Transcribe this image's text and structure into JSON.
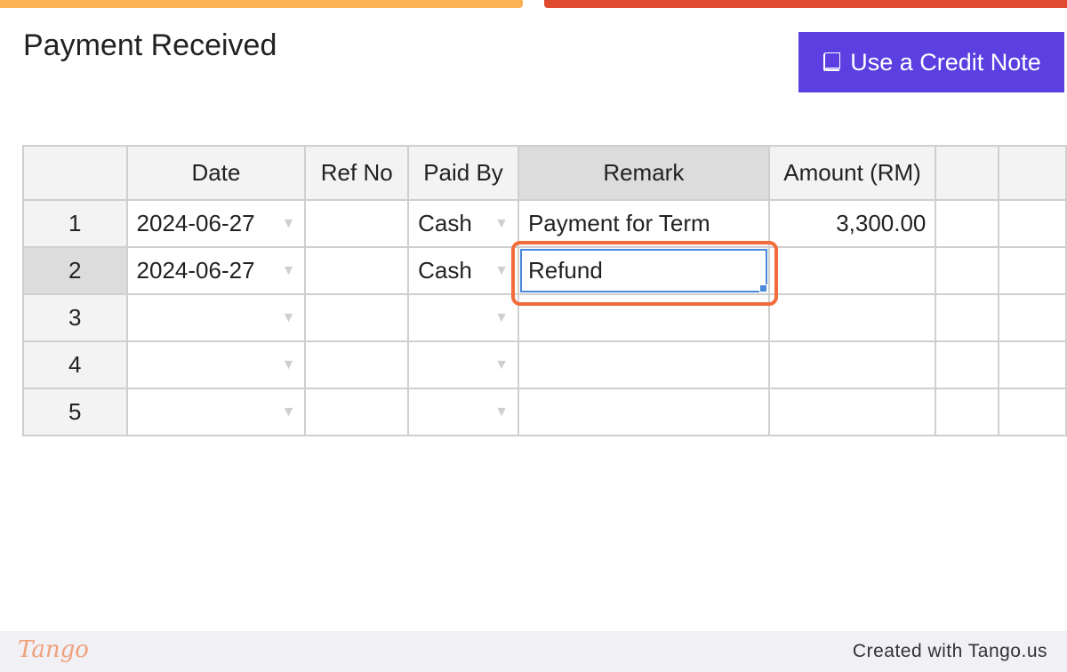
{
  "page_title": "Payment Received",
  "credit_button": {
    "label": "Use a Credit Note",
    "icon": "book-icon"
  },
  "table": {
    "headers": [
      "",
      "Date",
      "Ref No",
      "Paid By",
      "Remark",
      "Amount (RM)",
      "",
      ""
    ],
    "rows": [
      {
        "num": "1",
        "date": "2024-06-27",
        "ref": "",
        "paid_by": "Cash",
        "remark": "Payment for Term",
        "amount": "3,300.00"
      },
      {
        "num": "2",
        "date": "2024-06-27",
        "ref": "",
        "paid_by": "Cash",
        "remark": "Refund",
        "amount": ""
      },
      {
        "num": "3",
        "date": "",
        "ref": "",
        "paid_by": "",
        "remark": "",
        "amount": ""
      },
      {
        "num": "4",
        "date": "",
        "ref": "",
        "paid_by": "",
        "remark": "",
        "amount": ""
      },
      {
        "num": "5",
        "date": "",
        "ref": "",
        "paid_by": "",
        "remark": "",
        "amount": ""
      }
    ]
  },
  "footer": {
    "logo": "Tango",
    "created_with": "Created with Tango.us"
  },
  "colors": {
    "accent": "#5b3fe0",
    "highlight": "#f26b3a",
    "selection": "#4a89dc",
    "bar_left": "#fbb255",
    "bar_right": "#e04a2f"
  }
}
